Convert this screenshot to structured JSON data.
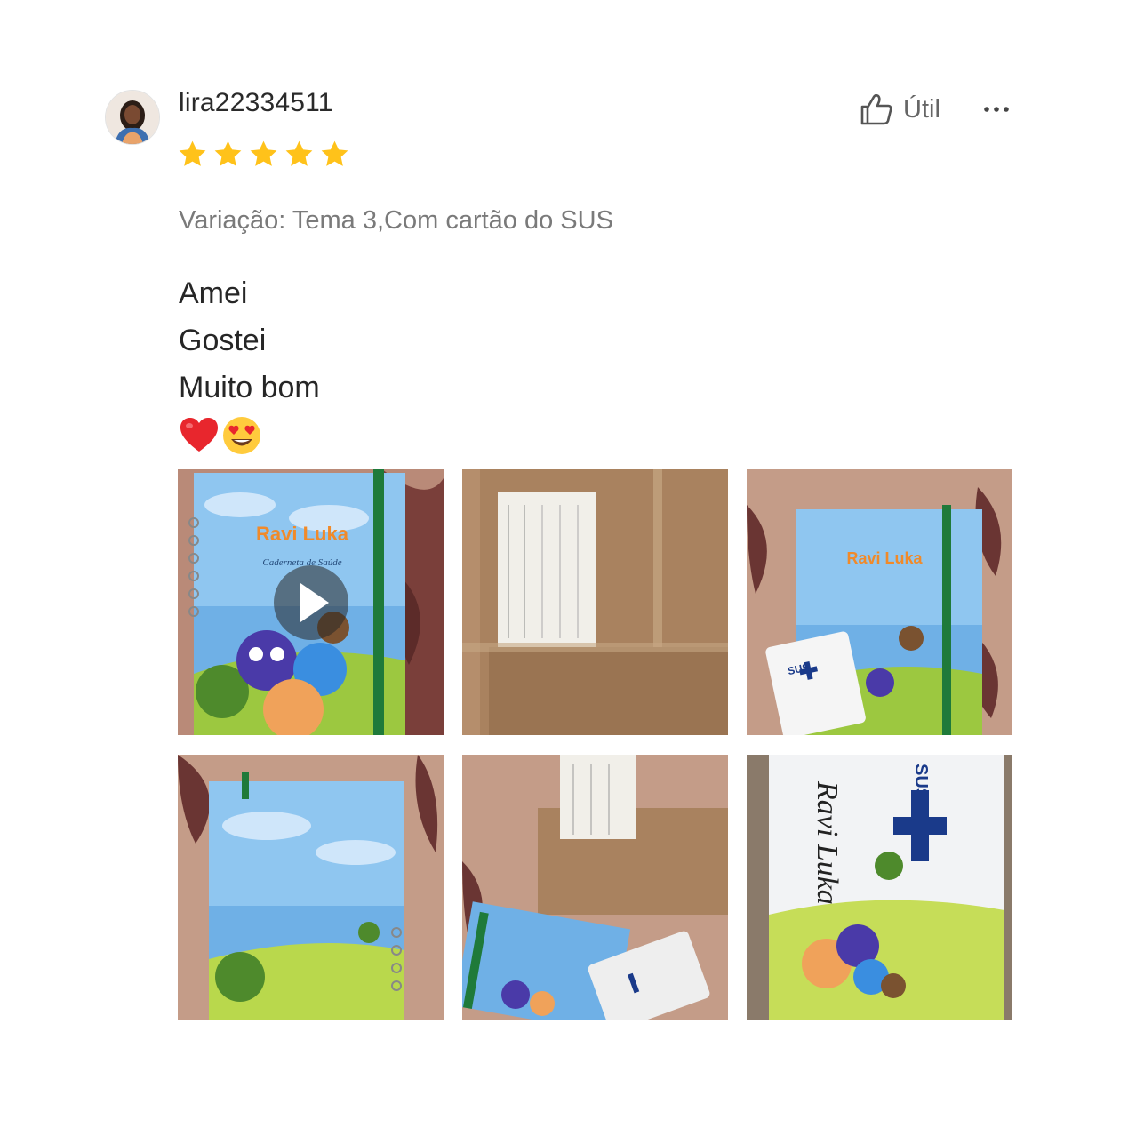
{
  "review": {
    "username": "lira22334511",
    "rating": 5,
    "max_rating": 5,
    "variation": "Variação: Tema 3,Com cartão do SUS",
    "lines": [
      "Amei",
      "Gostei",
      "Muito bom"
    ],
    "emojis": [
      "heart-emoji",
      "heart-eyes-emoji"
    ]
  },
  "actions": {
    "useful_label": "Útil",
    "more_label": "more-options"
  },
  "media": {
    "notebook_name": "Ravi Luka",
    "notebook_subtitle": "Caderneta de Saúde",
    "card_brand": "SUS",
    "items": [
      {
        "type": "video",
        "desc": "notebook-front"
      },
      {
        "type": "image",
        "desc": "package-label"
      },
      {
        "type": "image",
        "desc": "notebook-with-card"
      },
      {
        "type": "image",
        "desc": "notebook-back"
      },
      {
        "type": "image",
        "desc": "package-and-notebook"
      },
      {
        "type": "image",
        "desc": "sus-card-closeup"
      }
    ]
  },
  "colors": {
    "star": "#FFC21A",
    "text_primary": "#262626",
    "text_secondary": "#7a7a7a"
  }
}
